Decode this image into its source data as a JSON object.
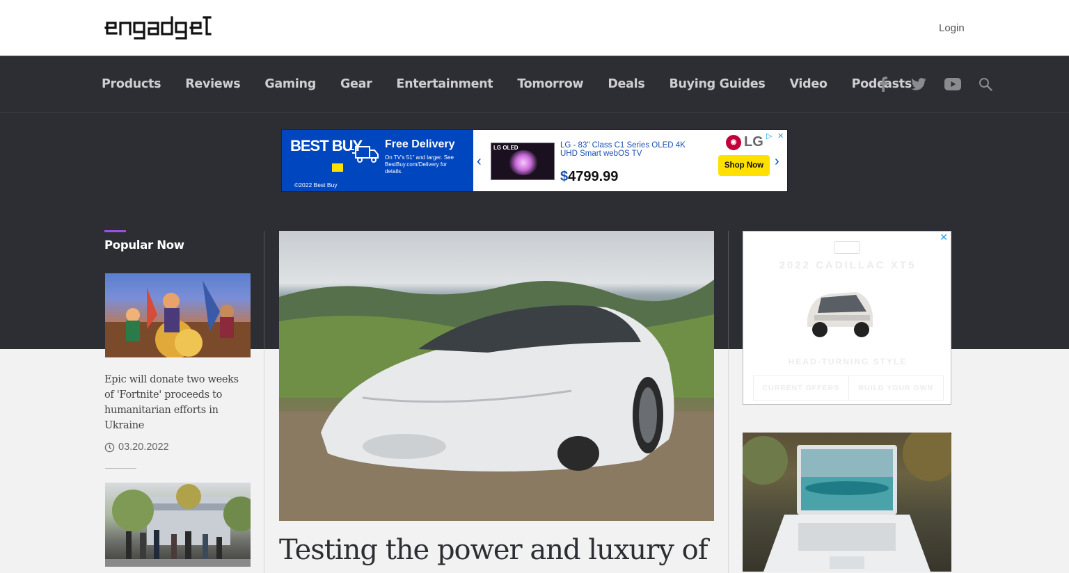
{
  "header": {
    "logo": "engadget",
    "login_label": "Login"
  },
  "nav": {
    "items": [
      "Products",
      "Reviews",
      "Gaming",
      "Gear",
      "Entertainment",
      "Tomorrow",
      "Deals",
      "Buying Guides",
      "Video",
      "Podcasts"
    ],
    "social_icons": [
      "facebook-icon",
      "twitter-icon",
      "youtube-icon",
      "search-icon"
    ]
  },
  "top_ad": {
    "brand": "BEST BUY",
    "headline": "Free Delivery",
    "subtext": "On TV's 51\" and larger. See BestBuy.com/Delivery for details.",
    "copyright": "©2022 Best Buy",
    "product_badge": "LG OLED",
    "product_name": "LG - 83\" Class C1 Series OLED 4K UHD Smart webOS TV",
    "price_symbol": "$",
    "price": "4799.99",
    "brand_logo": "LG",
    "cta": "Shop Now"
  },
  "popular": {
    "heading": "Popular Now",
    "stories": [
      {
        "title": "Epic will donate two weeks of 'Fortnite' proceeds to humanitarian efforts in Ukraine",
        "date": "03.20.2022"
      }
    ]
  },
  "hero": {
    "title": "Testing the power and luxury of"
  },
  "right_ad": {
    "title": "2022 CADILLAC XT5",
    "tagline": "HEAD-TURNING STYLE",
    "buttons": [
      "CURRENT OFFERS",
      "BUILD YOUR OWN"
    ]
  },
  "colors": {
    "nav_bg": "#2c2e33",
    "accent": "#9b51e0",
    "bestbuy_blue": "#0046be",
    "bestbuy_yellow": "#ffe000"
  }
}
